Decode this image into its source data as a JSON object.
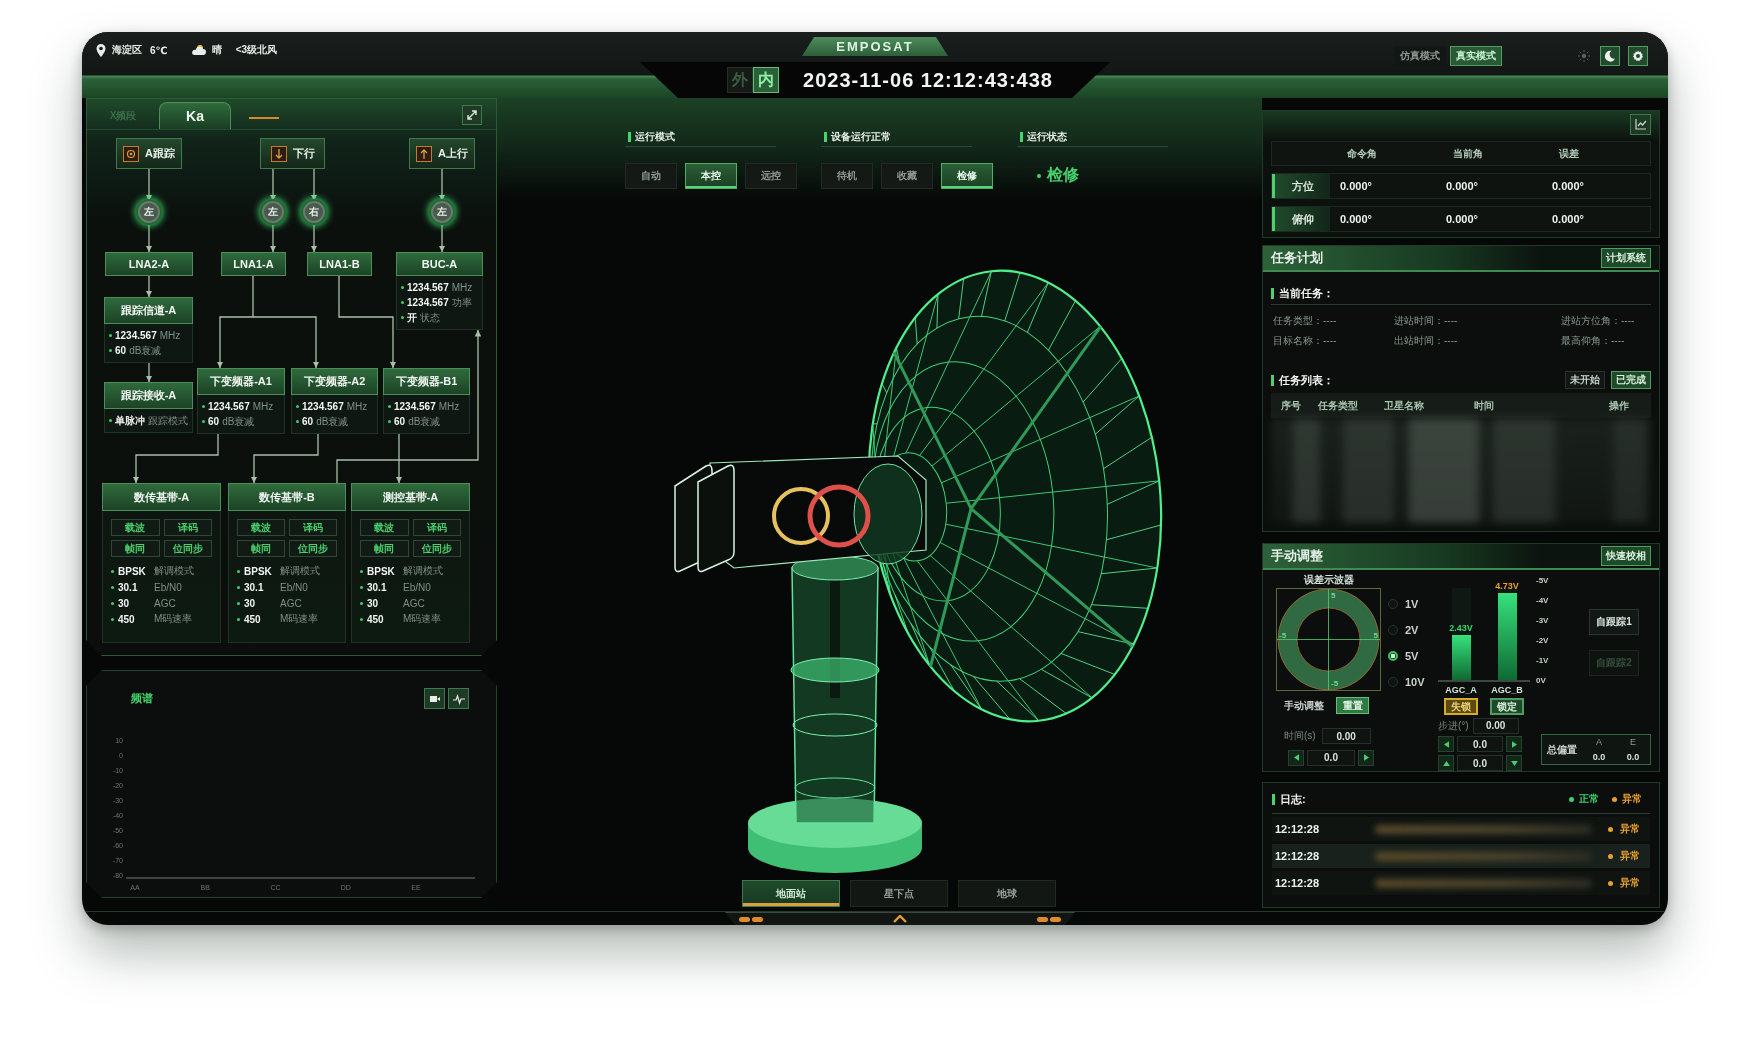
{
  "top_bar": {
    "location": "海淀区",
    "temperature": "6℃",
    "weather": "晴",
    "wind": "<3级北风",
    "logo": "EMPOSAT",
    "side_toggle": [
      {
        "label": "外",
        "selected": false
      },
      {
        "label": "内",
        "selected": true
      }
    ],
    "datetime": "2023-11-06 12:12:43:438",
    "mode_toggle": [
      {
        "label": "仿真模式",
        "selected": false
      },
      {
        "label": "真实模式",
        "selected": true
      }
    ],
    "theme_toggle": [
      {
        "kind": "sun",
        "selected": false
      },
      {
        "kind": "moon",
        "selected": true
      }
    ]
  },
  "link_panel": {
    "tabs": [
      {
        "label": "X频段",
        "selected": false
      },
      {
        "label": "Ka",
        "selected": true
      }
    ],
    "sources": [
      {
        "label": "A跟踪",
        "kind": "target"
      },
      {
        "label": "下行",
        "kind": "down"
      },
      {
        "label": "A上行",
        "kind": "up"
      }
    ],
    "switches": [
      {
        "label": "左"
      },
      {
        "label": "左"
      },
      {
        "label": "右"
      },
      {
        "label": "左"
      }
    ],
    "amplifiers": [
      {
        "name": "LNA2-A"
      },
      {
        "name": "LNA1-A"
      },
      {
        "name": "LNA1-B"
      },
      {
        "name": "BUC-A",
        "readings": [
          {
            "value": "1234.567",
            "unit": "MHz"
          },
          {
            "value": "1234.567",
            "unit": "功率"
          },
          {
            "value": "开",
            "unit": "状态"
          }
        ]
      }
    ],
    "tracking": [
      {
        "name": "跟踪信道-A",
        "readings": [
          {
            "value": "1234.567",
            "unit": "MHz"
          },
          {
            "value": "60",
            "unit": "dB衰减"
          }
        ]
      },
      {
        "name": "跟踪接收-A",
        "readings": [
          {
            "value": "单脉冲",
            "unit": "跟踪模式"
          }
        ]
      }
    ],
    "downconverters": [
      {
        "name": "下变频器-A1",
        "readings": [
          {
            "value": "1234.567",
            "unit": "MHz"
          },
          {
            "value": "60",
            "unit": "dB衰减"
          }
        ]
      },
      {
        "name": "下变频器-A2",
        "readings": [
          {
            "value": "1234.567",
            "unit": "MHz"
          },
          {
            "value": "60",
            "unit": "dB衰减"
          }
        ]
      },
      {
        "name": "下变频器-B1",
        "readings": [
          {
            "value": "1234.567",
            "unit": "MHz"
          },
          {
            "value": "60",
            "unit": "dB衰减"
          }
        ]
      }
    ],
    "basebands": [
      {
        "name": "数传基带-A",
        "indicators": [
          "载波",
          "译码",
          "帧同",
          "位同步"
        ],
        "readings": [
          {
            "value": "BPSK",
            "unit": "解调模式"
          },
          {
            "value": "30.1",
            "unit": "Eb/N0"
          },
          {
            "value": "30",
            "unit": "AGC"
          },
          {
            "value": "450",
            "unit": "M码速率"
          }
        ]
      },
      {
        "name": "数传基带-B",
        "indicators": [
          "载波",
          "译码",
          "帧同",
          "位同步"
        ],
        "readings": [
          {
            "value": "BPSK",
            "unit": "解调模式"
          },
          {
            "value": "30.1",
            "unit": "Eb/N0"
          },
          {
            "value": "30",
            "unit": "AGC"
          },
          {
            "value": "450",
            "unit": "M码速率"
          }
        ]
      },
      {
        "name": "测控基带-A",
        "indicators": [
          "载波",
          "译码",
          "帧同",
          "位同步"
        ],
        "readings": [
          {
            "value": "BPSK",
            "unit": "解调模式"
          },
          {
            "value": "30.1",
            "unit": "Eb/N0"
          },
          {
            "value": "30",
            "unit": "AGC"
          },
          {
            "value": "450",
            "unit": "M码速率"
          }
        ]
      }
    ]
  },
  "spectrum_panel": {
    "title": "频谱",
    "chart_data": {
      "type": "line",
      "categories": [
        "AA",
        "BB",
        "CC",
        "DD",
        "EE"
      ],
      "ylim": [
        -80,
        10
      ],
      "yticks": [
        10,
        0,
        -10,
        -20,
        -30,
        -40,
        -50,
        -60,
        -70,
        -80
      ]
    }
  },
  "mode_panel": {
    "groups": [
      {
        "kind": "buttons",
        "title": "运行模式",
        "buttons": [
          {
            "label": "自动",
            "selected": false
          },
          {
            "label": "本控",
            "selected": true
          },
          {
            "label": "远控",
            "selected": false
          }
        ]
      },
      {
        "kind": "buttons",
        "title": "设备运行正常",
        "buttons": [
          {
            "label": "待机",
            "selected": false
          },
          {
            "label": "收藏",
            "selected": false
          },
          {
            "label": "检修",
            "selected": true
          }
        ]
      },
      {
        "kind": "status",
        "title": "运行状态",
        "status": "检修"
      }
    ]
  },
  "view_tabs": [
    {
      "label": "地面站",
      "selected": true
    },
    {
      "label": "星下点",
      "selected": false
    },
    {
      "label": "地球",
      "selected": false
    }
  ],
  "angle_table": {
    "columns": [
      "命令角",
      "当前角",
      "误差"
    ],
    "rows": [
      {
        "label": "方位",
        "values": [
          "0.000°",
          "0.000°",
          "0.000°"
        ]
      },
      {
        "label": "俯仰",
        "values": [
          "0.000°",
          "0.000°",
          "0.000°"
        ]
      }
    ]
  },
  "task_plan": {
    "title": "任务计划",
    "action": "计划系统",
    "current_title": "当前任务：",
    "fields": [
      "任务类型：----",
      "进站时间：----",
      "进站方位角：----",
      "目标名称：----",
      "出站时间：----",
      "最高仰角：----"
    ],
    "list_title": "任务列表：",
    "filters": [
      {
        "label": "未开始",
        "selected": false
      },
      {
        "label": "已完成",
        "selected": true
      }
    ],
    "columns": [
      "序号",
      "任务类型",
      "卫星名称",
      "时间",
      "操作"
    ]
  },
  "manual": {
    "title": "手动调整",
    "action": "快速校相",
    "scope_title": "误差示波器",
    "scope_labels": [
      "5",
      "-5",
      "5",
      "-5"
    ],
    "ranges": [
      {
        "label": "1V",
        "selected": false
      },
      {
        "label": "2V",
        "selected": false
      },
      {
        "label": "5V",
        "selected": true
      },
      {
        "label": "10V",
        "selected": false
      }
    ],
    "agc": [
      {
        "name": "AGC_A",
        "reading": "2.43V",
        "color": "#3ad46e",
        "level": 0.49,
        "status": "失锁",
        "locked": false
      },
      {
        "name": "AGC_B",
        "reading": "4.73V",
        "color": "#e8a030",
        "level": 0.95,
        "status": "锁定",
        "locked": true
      }
    ],
    "scale": [
      "-5V",
      "-4V",
      "-3V",
      "-2V",
      "-1V",
      "0V"
    ],
    "adjust_label": "手动调整",
    "reset": "重置",
    "time_label": "时间(s)",
    "time_value": "0.00",
    "time_step": "0.0",
    "step_label": "步进(°)",
    "step_value": "0.00",
    "axis_steps": [
      {
        "kind": "horizontal",
        "value": "0.0"
      },
      {
        "kind": "vertical",
        "value": "0.0"
      }
    ],
    "tracking_buttons": [
      {
        "label": "自跟踪1",
        "disabled": false
      },
      {
        "label": "自跟踪2",
        "disabled": true
      }
    ],
    "offset": {
      "label": "总偏置",
      "columns": [
        "A",
        "E"
      ],
      "values": [
        "0.0",
        "0.0"
      ]
    }
  },
  "log": {
    "title": "日志:",
    "legend": [
      {
        "label": "正常",
        "color": "#3ad46e"
      },
      {
        "label": "异常",
        "color": "#e8a030"
      }
    ],
    "rows": [
      {
        "time": "12:12:28",
        "status": "异常",
        "color": "#e8a030"
      },
      {
        "time": "12:12:28",
        "status": "异常",
        "color": "#e8a030"
      },
      {
        "time": "12:12:28",
        "status": "异常",
        "color": "#e8a030"
      }
    ]
  }
}
